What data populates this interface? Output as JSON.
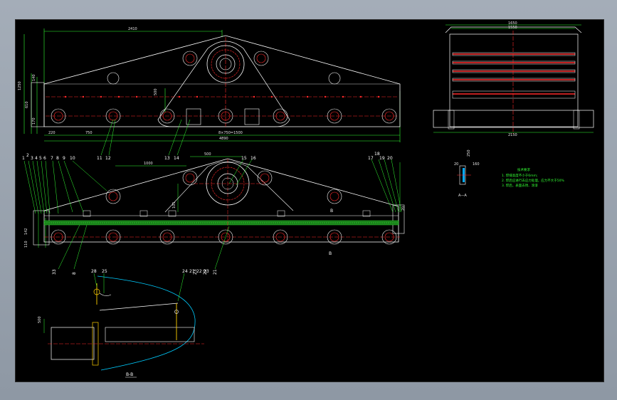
{
  "colors": {
    "background": "#000000",
    "outline": "#ffffff",
    "center_line": "#ff2a2a",
    "dimension": "#33ff33",
    "bolt": "#ffd000",
    "hidden": "#00ccff",
    "notes": "#33ff33"
  },
  "top_view": {
    "dim_total_width": "2410",
    "dim_overall_length": "4890",
    "dim_bolt_span": "8×750=1500",
    "dim_left_offset": "220",
    "dim_bolt_pitch": "750",
    "dim_height": "1250",
    "dim_side_a": "140",
    "dim_side_b": "610",
    "dim_side_c": "170",
    "dim_center": "500",
    "part_labels": [
      "11",
      "12",
      "13",
      "14"
    ]
  },
  "front_view": {
    "dim_offset": "1000",
    "dim_top": "500",
    "dim_center": "105",
    "dim_side": "20",
    "dim_left_a": "110",
    "dim_left_b": "142",
    "part_labels_left": [
      "1",
      "2",
      "3",
      "4",
      "5",
      "6",
      "7",
      "8",
      "9",
      "10"
    ],
    "part_labels_top": [
      "15",
      "16"
    ],
    "part_labels_right": [
      "17",
      "18",
      "19",
      "20"
    ],
    "part_labels_bottom": [
      "33",
      "8",
      "21",
      "22",
      "23"
    ],
    "section_mark": "B",
    "section_mark_bottom": "B"
  },
  "side_view": {
    "dim_top_outer": "1650",
    "dim_top_inner": "1550",
    "dim_bottom": "2150"
  },
  "detail_view": {
    "label": "A—A",
    "dim_height": "250",
    "dim_a": "20",
    "dim_b": "160"
  },
  "section_view": {
    "title": "B-B",
    "part_labels": [
      "28",
      "25",
      "24",
      "21",
      "22",
      "23"
    ]
  },
  "notes": {
    "title": "技术要求",
    "items": [
      "1. 焊缝高度不小于6mm;",
      "2. 焊后应进行去应力处理，应力不大于50%",
      "3. 焊后，表面去锈、涂漆"
    ]
  }
}
